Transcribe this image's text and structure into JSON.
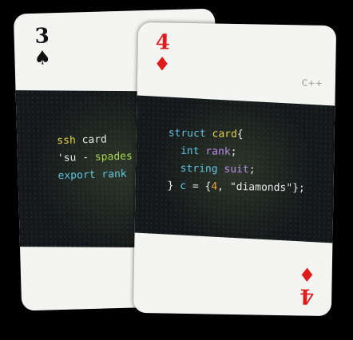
{
  "back_card": {
    "rank": "3",
    "suit_icon": "spade-icon",
    "suit_glyph": "♠",
    "code": {
      "line1_kw": "ssh",
      "line1_rest": " card",
      "line2_quote": "'su - ",
      "line2_rest": "spades",
      "line3_kw": "export",
      "line3_rest": " rank"
    }
  },
  "front_card": {
    "rank": "4",
    "suit_icon": "diamond-icon",
    "suit_glyph": "♦",
    "language": "C++",
    "code": {
      "l1_kw": "struct",
      "l1_name": " card",
      "l1_brace": "{",
      "l2_type": "int",
      "l2_name": " rank",
      "l2_end": ";",
      "l3_type": "string",
      "l3_name": " suit",
      "l3_end": ";",
      "l4_brace": "}",
      "l4_var": " c",
      "l4_eq": " = {",
      "l4_num": "4",
      "l4_sep": ", ",
      "l4_str": "\"diamonds\"",
      "l4_end": "};"
    }
  },
  "colors": {
    "background": "#000000",
    "card": "#f4f4f2",
    "band": "#14181a",
    "red_suit": "#e01b1b"
  }
}
